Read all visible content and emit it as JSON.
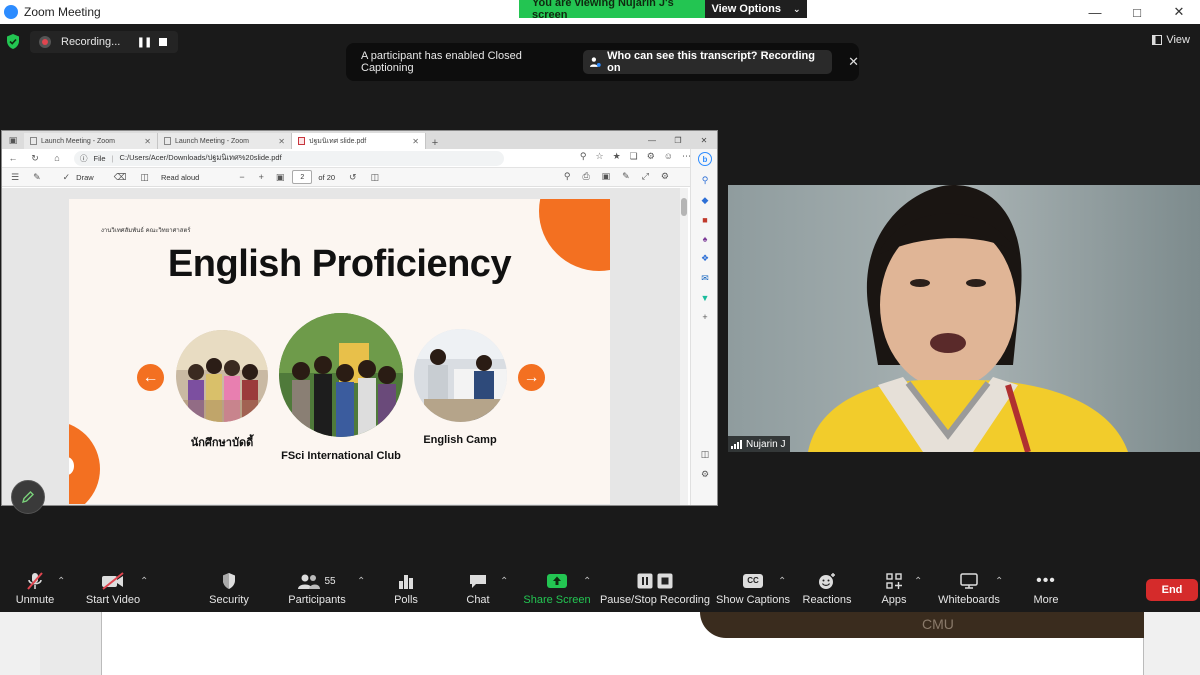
{
  "window": {
    "title": "Zoom Meeting"
  },
  "viewing_banner": {
    "text": "You are viewing Nujarin J's screen",
    "options_label": "View Options"
  },
  "recording": {
    "status": "Recording..."
  },
  "view_button": {
    "label": "View"
  },
  "cc_banner": {
    "message": "A participant has enabled Closed Captioning",
    "link_label": "Who can see this transcript? Recording on"
  },
  "browser": {
    "tabs": [
      {
        "label": "Launch Meeting - Zoom"
      },
      {
        "label": "Launch Meeting - Zoom"
      },
      {
        "label": "ปฐมนิเทศ slide.pdf"
      }
    ],
    "address": {
      "scheme_label": "File",
      "url": "C:/Users/Acer/Downloads/ปฐมนิเทศ%20slide.pdf"
    },
    "pdf_toolbar": {
      "draw_label": "Draw",
      "read_aloud_label": "Read aloud",
      "page_current": "2",
      "page_total": "of 20"
    }
  },
  "slide": {
    "caption": "งานวิเทศสัมพันธ์ คณะวิทยาศาสตร์",
    "title": "English Proficiency",
    "items": [
      {
        "label": "นักศึกษาบัดดี้"
      },
      {
        "label": "FSci International Club"
      },
      {
        "label": "English Camp"
      }
    ],
    "accent_color": "#f37021"
  },
  "video": {
    "participant_name": "Nujarin J"
  },
  "toolbar": {
    "unmute": "Unmute",
    "start_video": "Start Video",
    "security": "Security",
    "participants": "Participants",
    "participants_count": "55",
    "polls": "Polls",
    "chat": "Chat",
    "share_screen": "Share Screen",
    "pause_stop_recording": "Pause/Stop Recording",
    "show_captions": "Show Captions",
    "reactions": "Reactions",
    "apps": "Apps",
    "whiteboards": "Whiteboards",
    "more": "More",
    "end": "End",
    "cc_label": "CC"
  },
  "lower_strip": {
    "watermark": "CMU"
  },
  "colors": {
    "zoom_green": "#23c552",
    "end_red": "#d52b2b",
    "toolbar_bg": "#1a1a1a"
  }
}
